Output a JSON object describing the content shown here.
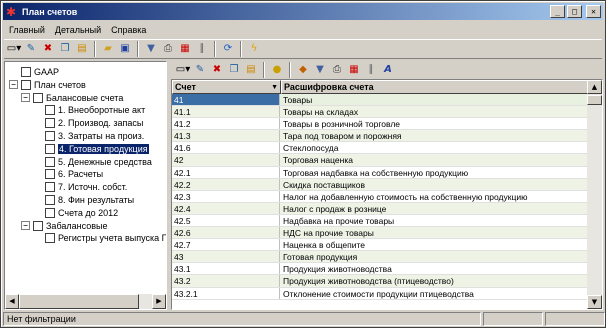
{
  "window": {
    "title": "План счетов"
  },
  "menu": [
    "Главный",
    "Детальный",
    "Справка"
  ],
  "toolbar_icons": [
    "new-doc-icon",
    "edit-icon",
    "delete-icon",
    "copy-icon",
    "properties-icon",
    "open-folder-icon",
    "save-icon",
    "filter-icon",
    "print-icon",
    "pdf-icon",
    "attach-icon",
    "refresh-icon",
    "run-icon"
  ],
  "right_toolbar_icons": [
    "new-doc-icon",
    "edit-icon",
    "delete-icon",
    "copy-icon",
    "properties-icon",
    "lock-icon",
    "group-icon",
    "filter-icon",
    "print-icon",
    "pdf-icon",
    "attach-icon",
    "font-icon"
  ],
  "tree": [
    {
      "label": "GAAP",
      "level": 0,
      "expander": null
    },
    {
      "label": "План счетов",
      "level": 0,
      "expander": "−"
    },
    {
      "label": "Балансовые счета",
      "level": 1,
      "expander": "−"
    },
    {
      "label": "1. Внеоборотные акт",
      "level": 2,
      "expander": null
    },
    {
      "label": "2. Производ. запасы",
      "level": 2,
      "expander": null
    },
    {
      "label": "3. Затраты на произ.",
      "level": 2,
      "expander": null
    },
    {
      "label": "4. Готовая продукция",
      "level": 2,
      "expander": null,
      "selected": true
    },
    {
      "label": "5. Денежные средства",
      "level": 2,
      "expander": null
    },
    {
      "label": "6. Расчеты",
      "level": 2,
      "expander": null
    },
    {
      "label": "7. Источн. собст.",
      "level": 2,
      "expander": null
    },
    {
      "label": "8. Фин результаты",
      "level": 2,
      "expander": null
    },
    {
      "label": "Счета до 2012",
      "level": 2,
      "expander": null
    },
    {
      "label": "Забалансовые",
      "level": 1,
      "expander": "−"
    },
    {
      "label": "Регистры учета выпуска П",
      "level": 2,
      "expander": null
    }
  ],
  "grid": {
    "headers": [
      "Счет",
      "Расшифровка счета"
    ],
    "rows": [
      [
        "41",
        "Товары"
      ],
      [
        "41.1",
        "Товары на складах"
      ],
      [
        "41.2",
        "Товары в розничной торговле"
      ],
      [
        "41.3",
        "Тара под товаром и порожняя"
      ],
      [
        "41.6",
        "Стеклопосуда"
      ],
      [
        "42",
        "Торговая наценка"
      ],
      [
        "42.1",
        "Торговая надбавка на собственную продукцию"
      ],
      [
        "42.2",
        "Скидка поставщиков"
      ],
      [
        "42.3",
        "Налог на добавленную стоимость на собственную продукцию"
      ],
      [
        "42.4",
        "Налог с продаж в рознице"
      ],
      [
        "42.5",
        "Надбавка на прочие товары"
      ],
      [
        "42.6",
        "НДС на прочие товары"
      ],
      [
        "42.7",
        "Наценка в общепите"
      ],
      [
        "43",
        "Готовая продукция"
      ],
      [
        "43.1",
        "Продукция животноводства"
      ],
      [
        "43.2",
        "Продукция животноводства (птицеводство)"
      ],
      [
        "43.2.1",
        "Отклонение стоимости продукции птицеводства"
      ]
    ]
  },
  "status": {
    "text": "Нет фильтрации"
  }
}
